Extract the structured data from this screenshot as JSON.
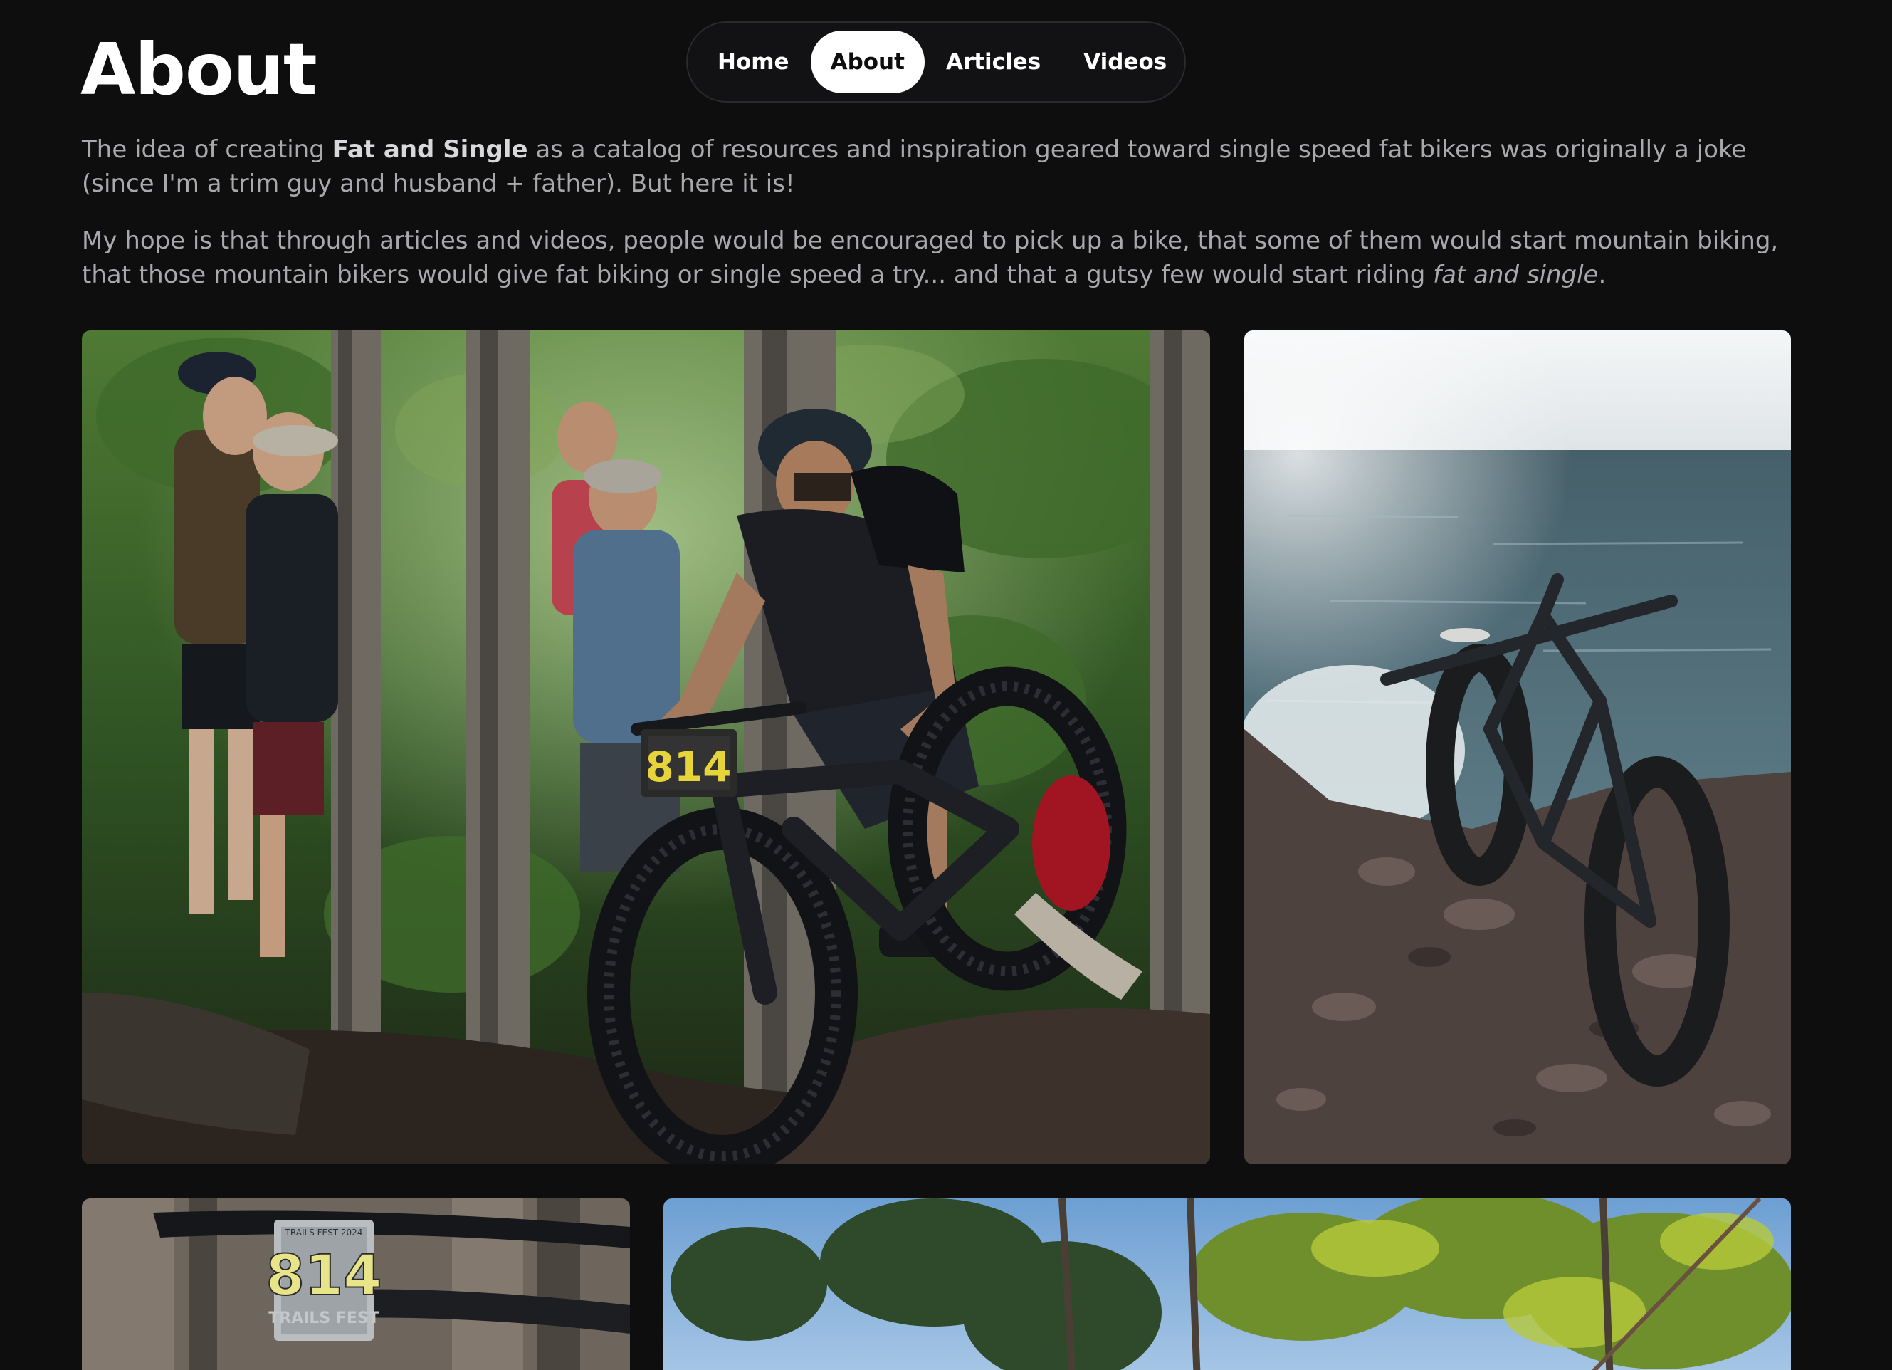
{
  "page": {
    "title": "About"
  },
  "nav": {
    "items": [
      {
        "label": "Home",
        "active": false
      },
      {
        "label": "About",
        "active": true
      },
      {
        "label": "Articles",
        "active": false
      },
      {
        "label": "Videos",
        "active": false
      }
    ]
  },
  "intro": {
    "p1_before": "The idea of creating ",
    "p1_bold": "Fat and Single",
    "p1_after": " as a catalog of resources and inspiration geared toward single speed fat bikers was originally a joke (since I'm a trim guy and husband + father). But here it is!",
    "p2_before": "My hope is that through articles and videos, people would be encouraged to pick up a bike, that some of them would start mountain biking, that those mountain bikers would give fat biking or single speed a try... and that a gutsy few would start riding ",
    "p2_italic": "fat and single",
    "p2_after": "."
  },
  "photos": {
    "race_bib": "814",
    "closeup_bib": "814",
    "closeup_bib_top": "TRAILS FEST 2024",
    "closeup_bib_bottom": "TRAILS FEST"
  },
  "colors": {
    "background": "#0e0e0f",
    "title": "#ffffff",
    "body_text": "#a9a9ad",
    "nav_active_bg": "#ffffff",
    "nav_border": "#2a2a2d"
  }
}
